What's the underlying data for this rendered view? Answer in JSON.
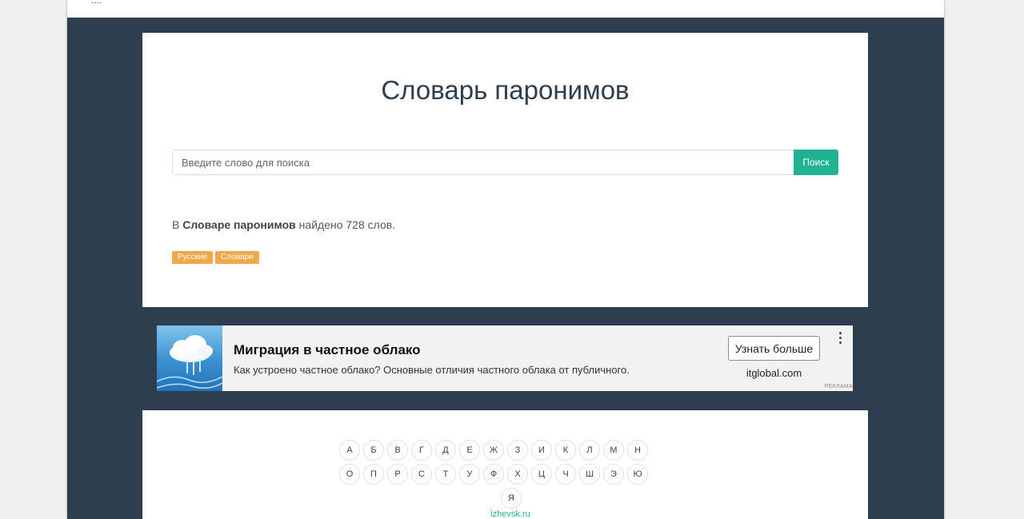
{
  "topbar": {
    "text": "...."
  },
  "header": {
    "title": "Словарь паронимов"
  },
  "search": {
    "placeholder": "Введите слово для поиска",
    "button_label": "Поиск"
  },
  "summary": {
    "prefix": "В ",
    "dictionary_name": "Словаре паронимов",
    "suffix": " найдено 728 слов."
  },
  "tags": [
    {
      "label": "Русские"
    },
    {
      "label": "Словари"
    }
  ],
  "ad": {
    "title": "Миграция в частное облако",
    "description": "Как устроено частное облако? Основные отличия частного облака от публичного.",
    "cta_label": "Узнать больше",
    "domain": "itglobal.com",
    "label": "РЕКЛАМА"
  },
  "alphabet": {
    "row1": [
      "А",
      "Б",
      "В",
      "Г",
      "Д",
      "Е",
      "Ж",
      "З",
      "И",
      "К",
      "Л",
      "М",
      "Н"
    ],
    "row2": [
      "О",
      "П",
      "Р",
      "С",
      "Т",
      "У",
      "Ф",
      "Х",
      "Ц",
      "Ч",
      "Ш",
      "Э",
      "Ю"
    ],
    "row3": [
      "Я"
    ],
    "site_link": "izhevsk.ru"
  },
  "colors": {
    "page_background": "#2d3e4e",
    "accent": "#1fb394",
    "tag": "#f0a94a"
  }
}
